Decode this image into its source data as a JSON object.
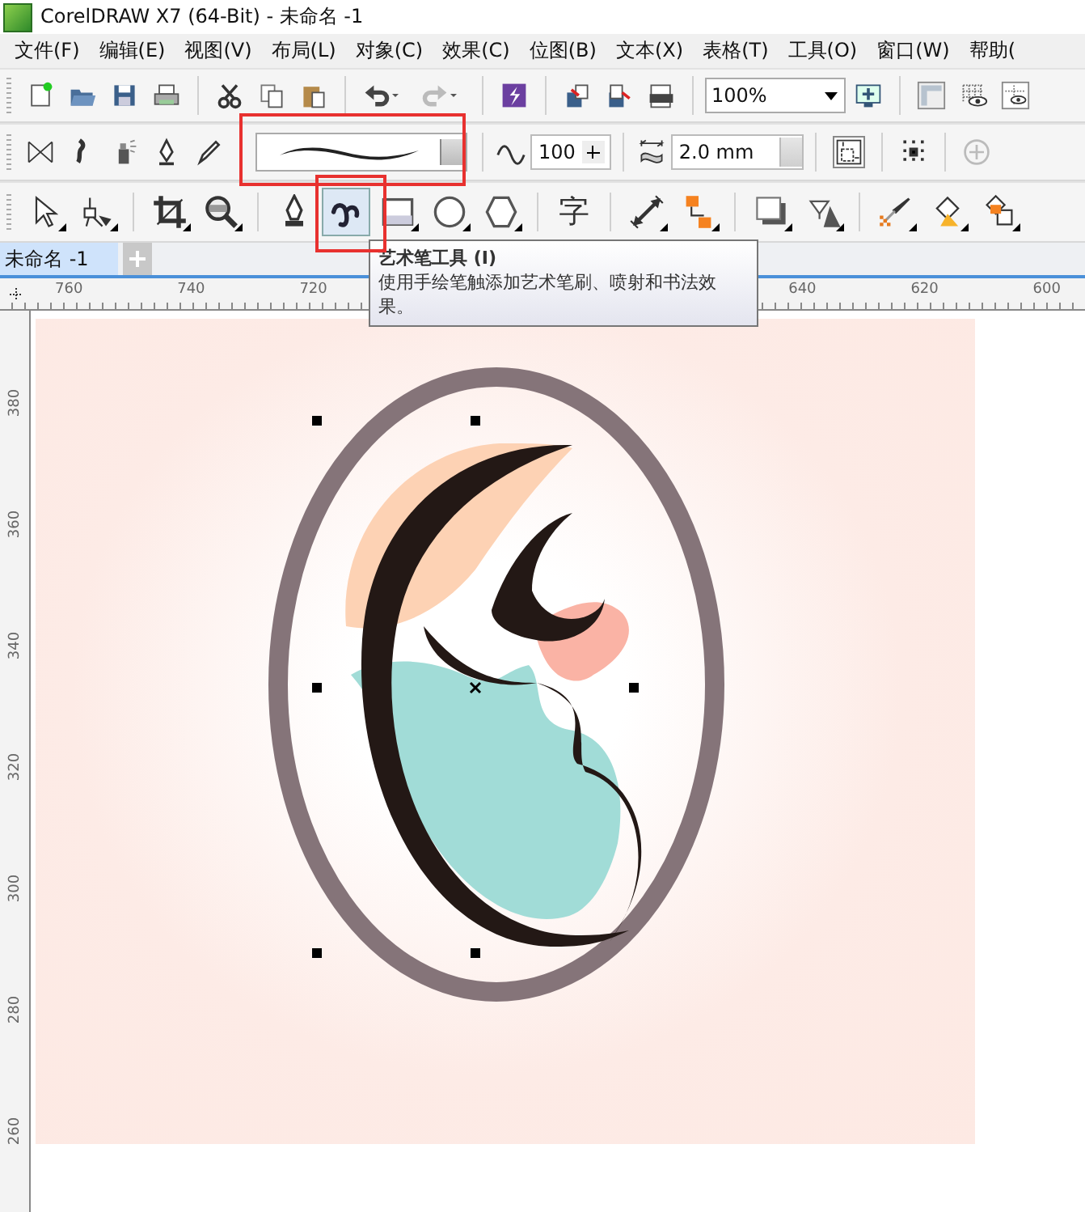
{
  "window": {
    "title": "CorelDRAW X7 (64-Bit) - 未命名 -1"
  },
  "menu": [
    "文件(F)",
    "编辑(E)",
    "视图(V)",
    "布局(L)",
    "对象(C)",
    "效果(C)",
    "位图(B)",
    "文本(X)",
    "表格(T)",
    "工具(O)",
    "窗口(W)",
    "帮助("
  ],
  "standard_toolbar": {
    "zoom_level": {
      "value": "100%"
    }
  },
  "property_bar": {
    "smoothing": {
      "value": "100"
    },
    "stroke_width": {
      "value": "2.0 mm"
    }
  },
  "toolbox": [
    {
      "kind": "pick",
      "selected": false
    },
    {
      "kind": "shape",
      "selected": false
    },
    {
      "kind": "crop",
      "selected": false
    },
    {
      "kind": "zoom",
      "selected": false
    },
    {
      "kind": "pen",
      "selected": false
    },
    {
      "kind": "artistic",
      "selected": true
    },
    {
      "kind": "rectangle",
      "selected": false
    },
    {
      "kind": "ellipse",
      "selected": false
    },
    {
      "kind": "polygon",
      "selected": false
    },
    {
      "kind": "text",
      "glyph": "字",
      "selected": false
    },
    {
      "kind": "dimension",
      "selected": false
    },
    {
      "kind": "connector",
      "selected": false
    },
    {
      "kind": "shadow",
      "selected": false
    },
    {
      "kind": "transparency",
      "selected": false
    },
    {
      "kind": "eyedropper",
      "selected": false
    },
    {
      "kind": "fill",
      "selected": false
    },
    {
      "kind": "smartfill",
      "selected": false
    }
  ],
  "document_tabs": [
    {
      "label": "未命名 -1",
      "selected": true
    }
  ],
  "tooltip": {
    "title": "艺术笔工具 (I)",
    "text": "使用手绘笔触添加艺术笔刷、喷射和书法效果。"
  },
  "rulers": {
    "horizontal": [
      "760",
      "740",
      "720",
      "640",
      "620",
      "600"
    ],
    "vertical": [
      "380",
      "360",
      "340",
      "320",
      "300",
      "280",
      "260"
    ]
  }
}
